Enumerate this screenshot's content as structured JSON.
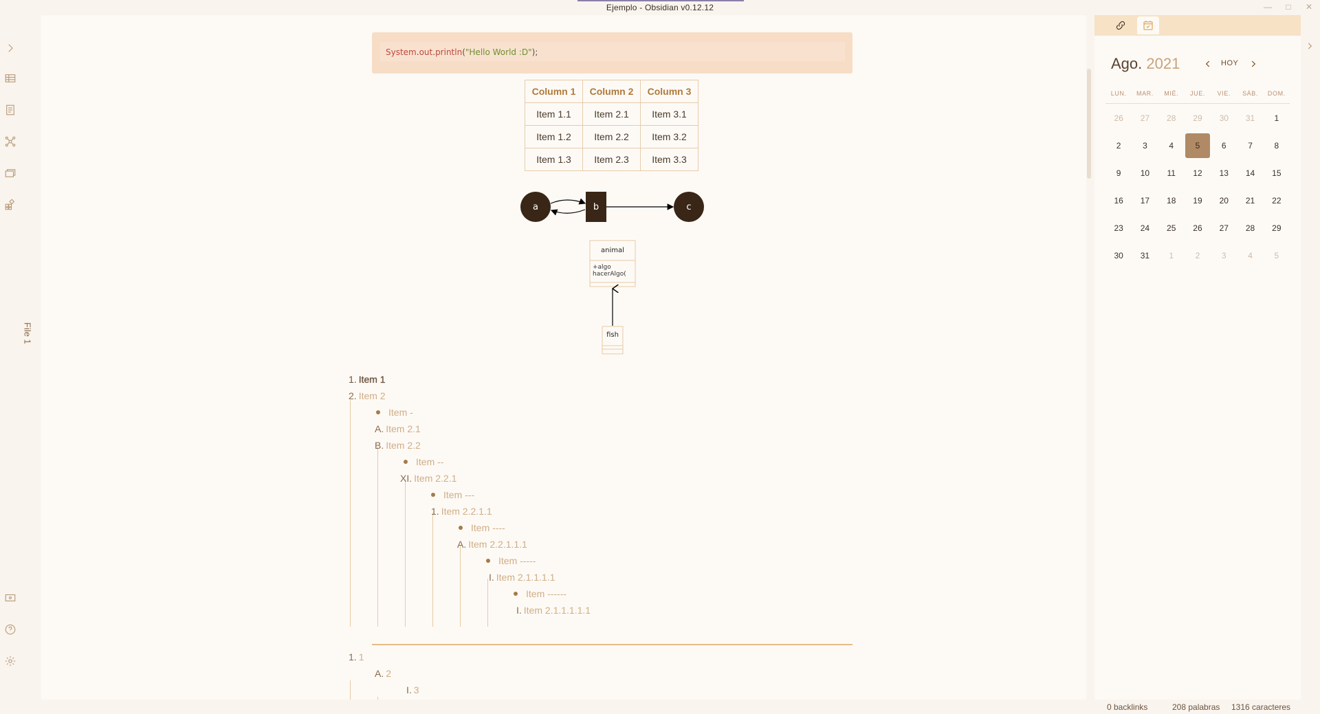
{
  "window": {
    "title": "Ejemplo - Obsidian v0.12.12",
    "controls": [
      "minimize",
      "maximize",
      "close"
    ]
  },
  "ribbon": {
    "icons": [
      "expand-icon",
      "table-icon",
      "document-icon",
      "graph-icon",
      "cards-icon",
      "plugins-icon",
      "vault-icon",
      "help-icon",
      "settings-icon"
    ]
  },
  "side_tab": {
    "label": "File 1"
  },
  "code": {
    "obj": "System",
    "dot1": ".",
    "field": "out",
    "dot2": ".",
    "method": "println",
    "open": "(",
    "string": "\"Hello World :D\"",
    "close": ");"
  },
  "table": {
    "headers": [
      "Column 1",
      "Column 2",
      "Column 3"
    ],
    "rows": [
      [
        "Item 1.1",
        "Item 2.1",
        "Item 3.1"
      ],
      [
        "Item 1.2",
        "Item 2.2",
        "Item 3.2"
      ],
      [
        "Item 1.3",
        "Item 2.3",
        "Item 3.3"
      ]
    ]
  },
  "graph": {
    "nodes": [
      "a",
      "b",
      "c"
    ]
  },
  "uml": {
    "class1": "animal",
    "attr": "+algo",
    "method": "hacerAlgo(",
    "class2": "fish"
  },
  "list1": [
    {
      "marker": "1.",
      "text": "Item 1"
    },
    {
      "marker": "2.",
      "text": "Item 2"
    },
    {
      "marker": "",
      "text": "Item -"
    },
    {
      "marker": "A.",
      "text": "Item 2.1"
    },
    {
      "marker": "B.",
      "text": "Item 2.2"
    },
    {
      "marker": "",
      "text": "Item --"
    },
    {
      "marker": "XI.",
      "text": "Item 2.2.1"
    },
    {
      "marker": "",
      "text": "Item ---"
    },
    {
      "marker": "1.",
      "text": "Item 2.2.1.1"
    },
    {
      "marker": "",
      "text": "Item ----"
    },
    {
      "marker": "A.",
      "text": "Item 2.2.1.1.1"
    },
    {
      "marker": "",
      "text": "Item -----"
    },
    {
      "marker": "I.",
      "text": "Item 2.1.1.1.1"
    },
    {
      "marker": "",
      "text": "Item ------"
    },
    {
      "marker": "I.",
      "text": "Item 2.1.1.1.1.1"
    }
  ],
  "list2": [
    {
      "marker": "1.",
      "text": "1"
    },
    {
      "marker": "A.",
      "text": "2"
    },
    {
      "marker": "I.",
      "text": "3"
    }
  ],
  "calendar": {
    "month": "Ago.",
    "year": "2021",
    "today_label": "HOY",
    "weekdays": [
      "LUN.",
      "MAR.",
      "MIÉ.",
      "JUE.",
      "VIE.",
      "SÁB.",
      "DOM."
    ],
    "weeks": [
      [
        "26",
        "27",
        "28",
        "29",
        "30",
        "31",
        "1"
      ],
      [
        "2",
        "3",
        "4",
        "5",
        "6",
        "7",
        "8"
      ],
      [
        "9",
        "10",
        "11",
        "12",
        "13",
        "14",
        "15"
      ],
      [
        "16",
        "17",
        "18",
        "19",
        "20",
        "21",
        "22"
      ],
      [
        "23",
        "24",
        "25",
        "26",
        "27",
        "28",
        "29"
      ],
      [
        "30",
        "31",
        "1",
        "2",
        "3",
        "4",
        "5"
      ]
    ],
    "adjacent_first_week": 6,
    "adjacent_last_week": 5,
    "selected_day": "5"
  },
  "status": {
    "backlinks": "0 backlinks",
    "words": "208 palabras",
    "chars": "1316 caracteres"
  }
}
